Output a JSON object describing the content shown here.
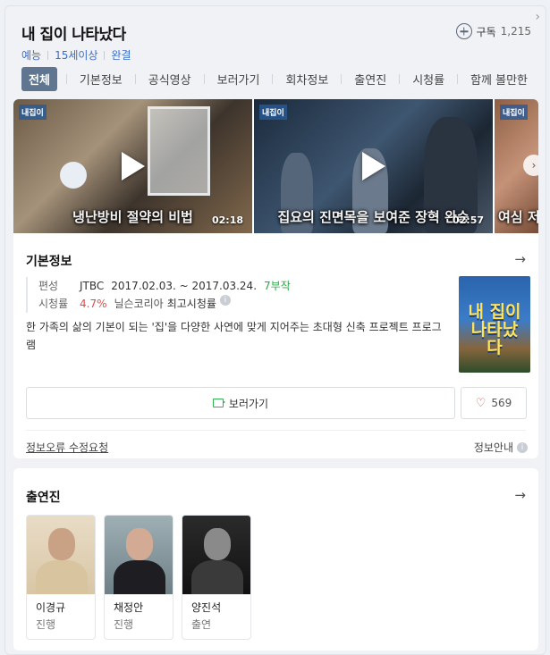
{
  "header": {
    "title": "내 집이 나타났다",
    "meta": [
      "예능",
      "15세이상",
      "완결"
    ],
    "subscribe_label": "구독",
    "subscribe_count": "1,215",
    "tabs": [
      "전체",
      "기본정보",
      "공식영상",
      "보러가기",
      "회차정보",
      "출연진",
      "시청률",
      "함께 볼만한"
    ]
  },
  "videos": [
    {
      "caption": "냉난방비 절약의 비법",
      "duration": "02:18"
    },
    {
      "caption": "집요의 진면목을 보여준 장혁 완승",
      "duration": "02:57"
    },
    {
      "caption": "여심 저"
    }
  ],
  "basic_info": {
    "title": "기본정보",
    "channel_label": "편성",
    "channel": "JTBC",
    "period": "2017.02.03. ~ 2017.03.24.",
    "episodes": "7부작",
    "rating_label": "시청률",
    "rating": "4.7%",
    "rating_source": "닐슨코리아",
    "rating_note": "최고시청률",
    "description": "한 가족의 삶의 기본이 되는 '집'을 다양한 사연에 맞게 지어주는 초대형 신축 프로젝트 프로그램",
    "poster_text": "내 집이 나타났다",
    "watch_button": "보러가기",
    "like_count": "569",
    "report_link": "정보오류 수정요청",
    "info_guide": "정보안내"
  },
  "cast": {
    "title": "출연진",
    "members": [
      {
        "name": "이경규",
        "role": "진행"
      },
      {
        "name": "채정안",
        "role": "진행"
      },
      {
        "name": "양진석",
        "role": "출연"
      }
    ]
  },
  "colors": {
    "accent_tab": "#5f7590",
    "meta_blue": "#3b6ec8",
    "episodes_green": "#27a745",
    "rating_red": "#e04b4b"
  }
}
